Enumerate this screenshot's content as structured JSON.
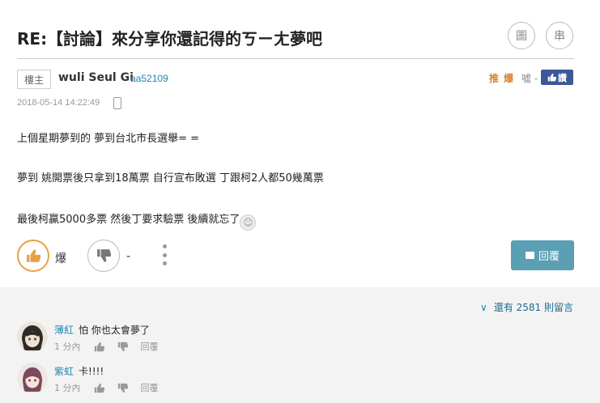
{
  "post": {
    "title": "RE:【討論】來分享你還記得的ㄎㄧㄤ夢吧",
    "icon_image_label": "圖",
    "icon_thread_label": "串",
    "op_badge": "樓主",
    "author": "wuli Seul Gi",
    "author_id": "aa52109",
    "recommend_label": "推 爆",
    "boo_label": "噓 -",
    "fb_label": "讚",
    "date": "2018-05-14 14:22:49",
    "paragraphs": [
      "上個星期夢到的  夢到台北市長選舉= =",
      "夢到 姚開票後只拿到18萬票  自行宣布敗選  丁跟柯2人都50幾萬票",
      "最後柯贏5000多票 然後丁要求驗票 後續就忘了"
    ],
    "like_label": "爆",
    "dislike_label": "-",
    "reply_label": "回覆",
    "icons": {
      "like": "thumbs-up-icon",
      "dislike": "thumbs-down-icon",
      "more": "kebab-icon",
      "reply": "speech-bubble-icon",
      "mobile": "mobile-phone-icon"
    },
    "colors": {
      "accent_orange": "#e8a046",
      "reply_button": "#5a9fb3",
      "link_blue": "#1e88b0",
      "facebook": "#3b5998"
    }
  },
  "comments": {
    "more_label": "還有 2581 則留言",
    "items": [
      {
        "name": "薄紅",
        "text": "怕 你也太會夢了",
        "time": "1 分內",
        "reply": "回覆"
      },
      {
        "name": "紫虹",
        "text": "卡!!!!",
        "time": "1 分內",
        "reply": "回覆"
      }
    ]
  }
}
